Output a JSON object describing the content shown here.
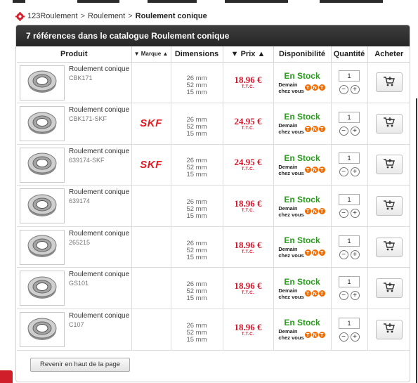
{
  "breadcrumb": {
    "items": [
      "123Roulement",
      "Roulement"
    ],
    "separator": ">",
    "current": "Roulement conique"
  },
  "panel": {
    "title": "7 références dans le catalogue Roulement conique"
  },
  "table": {
    "headers": {
      "produit": "Produit",
      "marque": "▼ Marque ▲",
      "dimensions": "Dimensions",
      "prix": "▼ Prix ▲",
      "disponibilite": "Disponibilité",
      "quantite": "Quantité",
      "acheter": "Acheter"
    },
    "rows": [
      {
        "name": "Roulement conique",
        "ref": "CBK171",
        "brand": "",
        "dims": [
          "26 mm",
          "52 mm",
          "15 mm"
        ],
        "price": "18.96 €",
        "ttc": "T.T.C.",
        "stock": "En Stock",
        "delivery1": "Demain",
        "delivery2": "chez vous",
        "qty": "1"
      },
      {
        "name": "Roulement conique",
        "ref": "CBK171-SKF",
        "brand": "SKF",
        "dims": [
          "26 mm",
          "52 mm",
          "15 mm"
        ],
        "price": "24.95 €",
        "ttc": "T.T.C.",
        "stock": "En Stock",
        "delivery1": "Demain",
        "delivery2": "chez vous",
        "qty": "1"
      },
      {
        "name": "Roulement conique",
        "ref": "639174-SKF",
        "brand": "SKF",
        "dims": [
          "26 mm",
          "52 mm",
          "15 mm"
        ],
        "price": "24.95 €",
        "ttc": "T.T.C.",
        "stock": "En Stock",
        "delivery1": "Demain",
        "delivery2": "chez vous",
        "qty": "1"
      },
      {
        "name": "Roulement conique",
        "ref": "639174",
        "brand": "",
        "dims": [
          "26 mm",
          "52 mm",
          "15 mm"
        ],
        "price": "18.96 €",
        "ttc": "T.T.C.",
        "stock": "En Stock",
        "delivery1": "Demain",
        "delivery2": "chez vous",
        "qty": "1"
      },
      {
        "name": "Roulement conique",
        "ref": "265215",
        "brand": "",
        "dims": [
          "26 mm",
          "52 mm",
          "15 mm"
        ],
        "price": "18.96 €",
        "ttc": "T.T.C.",
        "stock": "En Stock",
        "delivery1": "Demain",
        "delivery2": "chez vous",
        "qty": "1"
      },
      {
        "name": "Roulement conique",
        "ref": "GS101",
        "brand": "",
        "dims": [
          "26 mm",
          "52 mm",
          "15 mm"
        ],
        "price": "18.96 €",
        "ttc": "T.T.C.",
        "stock": "En Stock",
        "delivery1": "Demain",
        "delivery2": "chez vous",
        "qty": "1"
      },
      {
        "name": "Roulement conique",
        "ref": "C107",
        "brand": "",
        "dims": [
          "26 mm",
          "52 mm",
          "15 mm"
        ],
        "price": "18.96 €",
        "ttc": "T.T.C.",
        "stock": "En Stock",
        "delivery1": "Demain",
        "delivery2": "chez vous",
        "qty": "1"
      }
    ]
  },
  "carrier": {
    "letters": [
      "T",
      "N",
      "T"
    ]
  },
  "controls": {
    "minus": "−",
    "plus": "+"
  },
  "back_button": {
    "label": "Revenir en haut de la page"
  },
  "icons": {
    "breadcrumb_logo": "gear-logo-icon",
    "cart": "add-to-cart-icon",
    "product_image": "tapered-bearing-icon"
  },
  "colors": {
    "header_bg": "#2e2e2e",
    "price": "#d4152a",
    "stock": "#2b9b1f",
    "brand": "#e31b23",
    "tnt": "#f26b00"
  }
}
